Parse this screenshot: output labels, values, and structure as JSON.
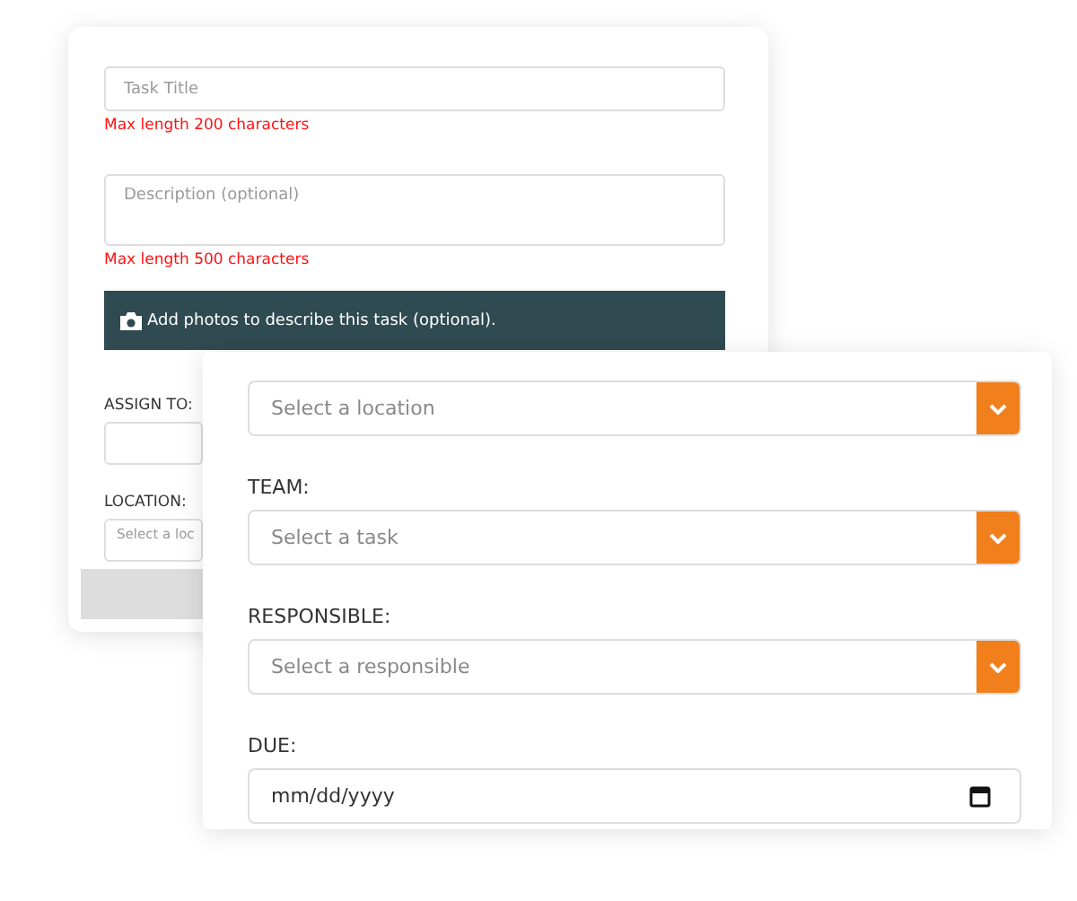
{
  "back_form": {
    "title_field": {
      "placeholder": "Task Title"
    },
    "title_error": "Max length 200 characters",
    "description_field": {
      "placeholder": "Description (optional)"
    },
    "description_error": "Max length 500 characters",
    "photos_bar": "Add photos to describe this task (optional).",
    "assign_label": "ASSIGN TO:",
    "location_label": "LOCATION:",
    "location_field": {
      "placeholder": "Select a loc"
    }
  },
  "front_form": {
    "fields": [
      {
        "kind": "select",
        "placeholder": "Select a location"
      },
      {
        "kind": "select",
        "label": "TEAM:",
        "placeholder": "Select a task"
      },
      {
        "kind": "select",
        "label": "RESPONSIBLE:",
        "placeholder": "Select a responsible"
      },
      {
        "kind": "date",
        "label": "DUE:",
        "placeholder": "mm/dd/yyyy"
      }
    ]
  }
}
